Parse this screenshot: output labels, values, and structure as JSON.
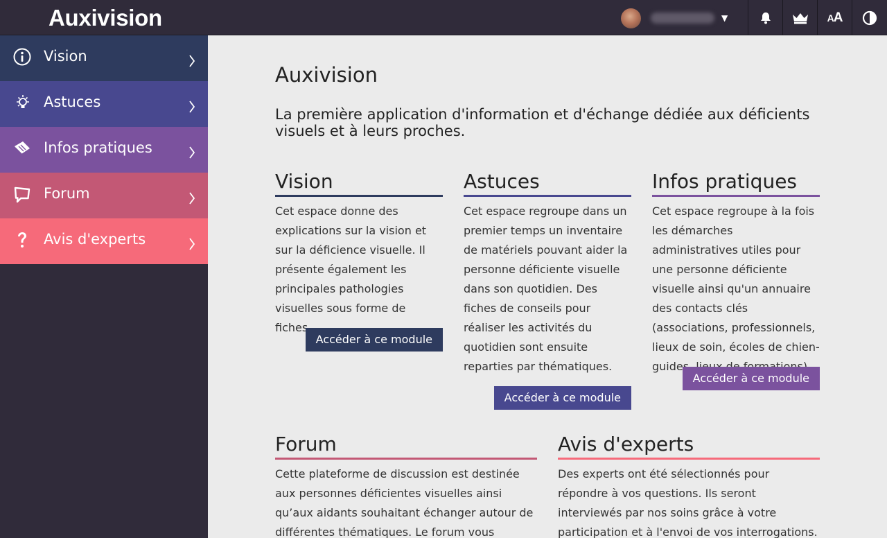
{
  "header": {
    "logo": "Auxivision",
    "user": {
      "name_blurred": true,
      "dropdown_icon": "caret-down-icon"
    },
    "buttons": [
      {
        "icon": "bell-icon"
      },
      {
        "icon": "crown-icon"
      },
      {
        "icon": "font-size-icon",
        "text": "AA"
      },
      {
        "icon": "contrast-icon"
      }
    ]
  },
  "sidebar": {
    "items": [
      {
        "label": "Vision",
        "icon": "info-icon",
        "color": "#2e3b5e"
      },
      {
        "label": "Astuces",
        "icon": "lightbulb-icon",
        "color": "#48488f"
      },
      {
        "label": "Infos pratiques",
        "icon": "book-icon",
        "color": "#7b529e"
      },
      {
        "label": "Forum",
        "icon": "chat-icon",
        "color": "#c35875"
      },
      {
        "label": "Avis d'experts",
        "icon": "question-icon",
        "color": "#f66a7a"
      }
    ]
  },
  "main": {
    "title": "Auxivision",
    "intro": "La première application d'information et d'échange dédiée aux déficients visuels et à leurs proches.",
    "cards": [
      {
        "title": "Vision",
        "text": "Cet espace donne des explications sur la vision et sur la déficience visuelle. Il présente également les principales pathologies visuelles sous forme de fiches.",
        "button": "Accéder à ce module",
        "color": "#2e3b5e"
      },
      {
        "title": "Astuces",
        "text": "Cet espace regroupe dans un premier temps un inventaire de matériels pouvant aider la personne déficiente visuelle dans son quotidien. Des fiches de conseils pour réaliser les activités du quotidien sont ensuite reparties par thématiques.",
        "button": "Accéder à ce module",
        "color": "#48488f"
      },
      {
        "title": "Infos pratiques",
        "text": "Cet espace regroupe à la fois les démarches administratives utiles pour une personne déficiente visuelle ainsi qu'un annuaire des contacts clés (associations, professionnels, lieux de soin, écoles de chien-guides, lieux de formations).",
        "button": "Accéder à ce module",
        "color": "#7b529e"
      },
      {
        "title": "Forum",
        "text": "Cette plateforme de discussion est destinée aux personnes déficientes visuelles ainsi qu’aux aidants souhaitant échanger autour de différentes thématiques. Le forum vous",
        "color": "#c35875"
      },
      {
        "title": "Avis d'experts",
        "text": "Des experts ont été sélectionnés pour répondre à vos questions. Ils seront interviewés par nos soins grâce à votre participation et à l'envoi de vos interrogations.",
        "color": "#f66a7a"
      }
    ]
  }
}
